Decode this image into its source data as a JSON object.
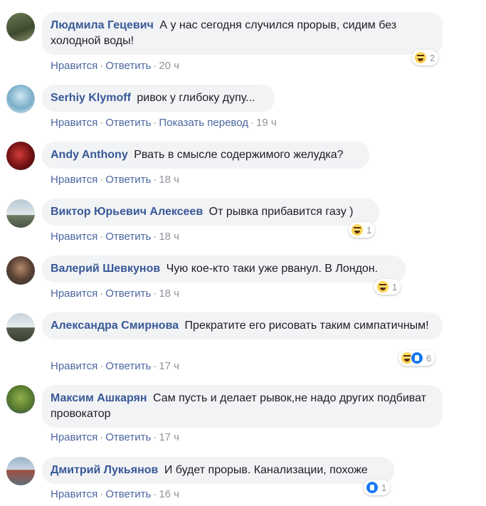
{
  "labels": {
    "like": "Нравится",
    "reply": "Ответить",
    "translate": "Показать перевод",
    "sep": "·"
  },
  "colors": {
    "author": "#385898",
    "link": "#4b67a1",
    "bubble": "#f2f3f5",
    "meta": "#90949c"
  },
  "comments": [
    {
      "author": "Людмила Гецевич",
      "text": "А у нас сегодня случился прорыв, сидим без холодной воды!",
      "time": "20 ч",
      "reaction_icons": [
        "haha-icon"
      ],
      "reaction_count": "2",
      "has_translate": false
    },
    {
      "author": "Serhiy Klymoff",
      "text": "ривок у глибоку дупу...",
      "time": "19 ч",
      "reaction_icons": [],
      "reaction_count": "",
      "has_translate": true
    },
    {
      "author": "Andy Anthony",
      "text": "Рвать в смысле содержимого желудка?",
      "time": "18 ч",
      "reaction_icons": [],
      "reaction_count": "",
      "has_translate": false
    },
    {
      "author": "Виктор Юрьевич Алексеев",
      "text": "От рывка прибавится газу )",
      "time": "18 ч",
      "reaction_icons": [
        "haha-icon"
      ],
      "reaction_count": "1",
      "has_translate": false
    },
    {
      "author": "Валерий Шевкунов",
      "text": "Чую кое-кто таки уже рванул. В Лондон.",
      "time": "18 ч",
      "reaction_icons": [
        "haha-icon"
      ],
      "reaction_count": "1",
      "has_translate": false
    },
    {
      "author": "Александра Смирнова",
      "text": "Прекратите его рисовать таким симпатичным!",
      "time": "17 ч",
      "reaction_icons": [
        "haha-icon",
        "like-icon"
      ],
      "reaction_count": "6",
      "has_translate": false
    },
    {
      "author": "Максим Ашкарян",
      "text": "Сам пусть и делает рывок,не надо других подбиват провокатор",
      "time": "17 ч",
      "reaction_icons": [],
      "reaction_count": "",
      "has_translate": false
    },
    {
      "author": "Дмитрий Лукьянов",
      "text": "И будет прорыв. Канализации, похоже",
      "time": "16 ч",
      "reaction_icons": [
        "like-icon"
      ],
      "reaction_count": "1",
      "has_translate": false
    }
  ]
}
